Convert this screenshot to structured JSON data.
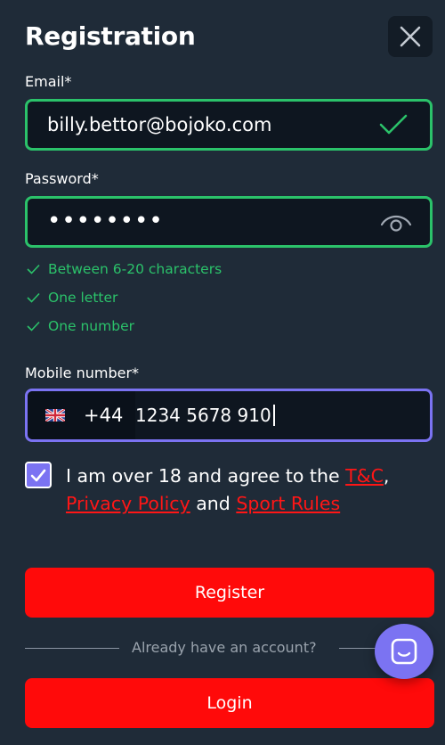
{
  "header": {
    "title": "Registration"
  },
  "email": {
    "label": "Email*",
    "value": "billy.bettor@bojoko.com"
  },
  "password": {
    "label": "Password*",
    "value": "••••••••",
    "rules": [
      "Between 6-20 characters",
      "One letter",
      "One number"
    ]
  },
  "mobile": {
    "label": "Mobile number*",
    "dial_code": "+44",
    "value": "1234 5678 910"
  },
  "agreement": {
    "text_before": "I am over 18 and agree to the ",
    "tc_link": "T&C",
    "comma": ",",
    "privacy_link": "Privacy Policy",
    "and": " and ",
    "sport_link": "Sport Rules",
    "checked": true
  },
  "actions": {
    "register_label": "Register",
    "divider_text": "Already have an account?",
    "login_label": "Login"
  },
  "colors": {
    "background": "#1f2b38",
    "valid": "#2bc26a",
    "focus": "#7b73f2",
    "primary_button": "#ff0a0a",
    "link": "#ff1616"
  },
  "icons": [
    "close-icon",
    "check-icon",
    "eye-icon",
    "uk-flag-icon",
    "chat-icon"
  ]
}
